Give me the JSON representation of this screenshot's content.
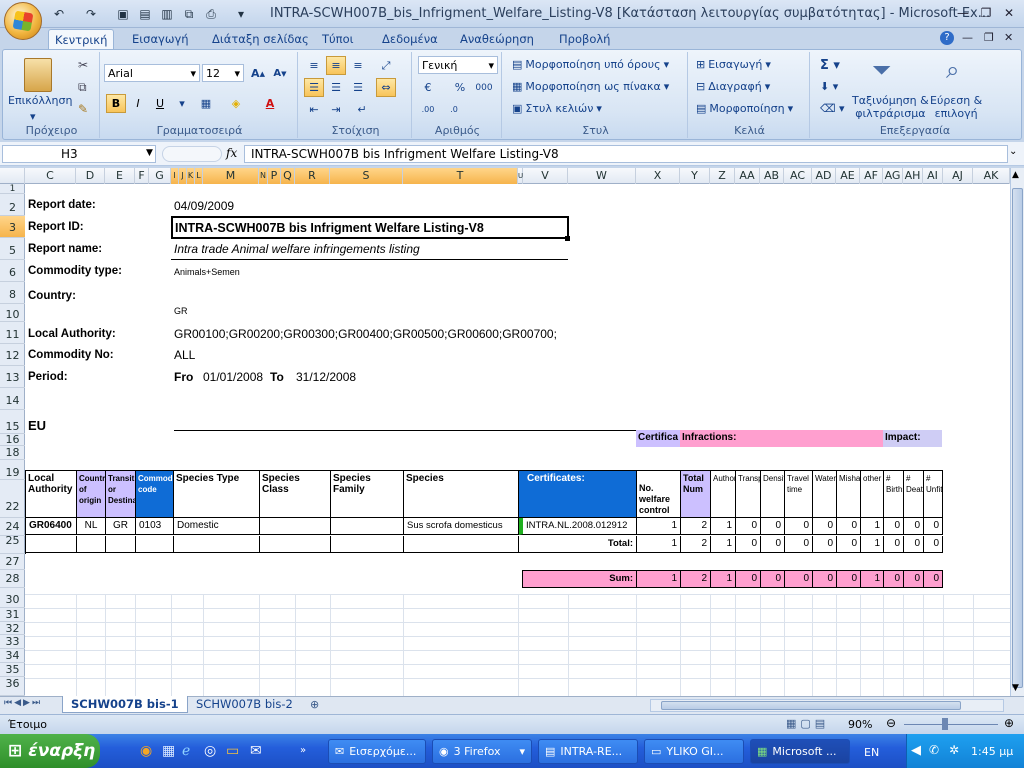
{
  "window": {
    "title": "INTRA-SCWH007B_bis_Infrigment_Welfare_Listing-V8  [Κατάσταση λειτουργίας συμβατότητας] - Microsoft Ex..."
  },
  "ribbon_tabs": [
    "Κεντρική",
    "Εισαγωγή",
    "Διάταξη σελίδας",
    "Τύποι",
    "Δεδομένα",
    "Αναθεώρηση",
    "Προβολή"
  ],
  "ribbon": {
    "clipboard": {
      "paste": "Επικόλληση",
      "label": "Πρόχειρο"
    },
    "font": {
      "name": "Arial",
      "size": "12",
      "label": "Γραμματοσειρά"
    },
    "alignment": {
      "label": "Στοίχιση"
    },
    "number": {
      "format": "Γενική",
      "label": "Αριθμός"
    },
    "styles": {
      "conditional": "Μορφοποίηση υπό όρους",
      "as_table": "Μορφοποίηση ως πίνακα",
      "cell_styles": "Στυλ κελιών",
      "label": "Στυλ"
    },
    "cells": {
      "insert": "Εισαγωγή",
      "delete": "Διαγραφή",
      "format": "Μορφοποίηση",
      "label": "Κελιά"
    },
    "editing": {
      "sort": "Ταξινόμηση &",
      "sort2": "φιλτράρισμα",
      "find": "Εύρεση &",
      "find2": "επιλογή",
      "label": "Επεξεργασία"
    }
  },
  "formula_bar": {
    "name_box": "H3",
    "fx": "fx",
    "value": "INTRA-SCWH007B bis Infrigment Welfare Listing-V8"
  },
  "columns": [
    "C",
    "D",
    "E",
    "F",
    "G",
    "I",
    "J",
    "K",
    "L",
    "M",
    "N",
    "P",
    "Q",
    "R",
    "S",
    "T",
    "U",
    "V",
    "W",
    "X",
    "Y",
    "Z",
    "AA",
    "AB",
    "AC",
    "AD",
    "AE",
    "AF",
    "AG",
    "AH",
    "AI",
    "AJ",
    "AK"
  ],
  "rows": [
    "1",
    "2",
    "3",
    "5",
    "6",
    "8",
    "10",
    "11",
    "12",
    "13",
    "14",
    "15",
    "16",
    "18",
    "19",
    "22",
    "24",
    "25",
    "27",
    "28",
    "30",
    "31",
    "32",
    "33",
    "34",
    "35",
    "36"
  ],
  "report": {
    "date_label": "Report date:",
    "date": "04/09/2009",
    "id_label": "Report ID:",
    "id": "INTRA-SCWH007B bis Infrigment Welfare Listing-V8",
    "name_label": "Report name:",
    "name": "Intra trade Animal welfare infringements listing",
    "commodity_label": "Commodity type:",
    "commodity": "Animals+Semen",
    "country_label": "Country:",
    "country": "GR",
    "authority_label": "Local Authority:",
    "authority": "GR00100;GR00200;GR00300;GR00400;GR00500;GR00600;GR00700;",
    "commodity_no_label": "Commodity No:",
    "commodity_no": "ALL",
    "period_label": "Period:",
    "from_label": "Fro",
    "from": "01/01/2008",
    "to_label": "To",
    "to": "31/12/2008",
    "section": "EU"
  },
  "group_headers": {
    "certifica": "Certifica",
    "infractions": "Infractions:",
    "impact": "Impact:"
  },
  "table_headers": [
    "Local Authority",
    "Country of origin",
    "Transit or Destination",
    "Commodity code",
    "Species Type",
    "Species Class",
    "Species Family",
    "Species",
    "Certificates:",
    "No. welfare control",
    "Total Num",
    "Authorisation",
    "Transport",
    "Density",
    "Travel time",
    "Watering/feeding",
    "Mishandling",
    "other",
    "# Births",
    "# Deaths",
    "# Unfit"
  ],
  "table_row": [
    "GR06400",
    "NL",
    "GR",
    "0103",
    "Domestic",
    "",
    "",
    "Sus scrofa domesticus",
    "INTRA.NL.2008.012912",
    "1",
    "2",
    "1",
    "0",
    "0",
    "0",
    "0",
    "0",
    "1",
    "0",
    "0",
    "0"
  ],
  "total_row": {
    "label": "Total:",
    "values": [
      "1",
      "2",
      "1",
      "0",
      "0",
      "0",
      "0",
      "0",
      "1",
      "0",
      "0",
      "0"
    ]
  },
  "sum_row": {
    "label": "Sum:",
    "values": [
      "1",
      "2",
      "1",
      "0",
      "0",
      "0",
      "0",
      "0",
      "1",
      "0",
      "0",
      "0"
    ]
  },
  "sheets": [
    "SCHW007B bis-1",
    "SCHW007B bis-2"
  ],
  "status": {
    "ready": "Έτοιμο",
    "zoom": "90%"
  },
  "taskbar": {
    "start": "έναρξη",
    "items": [
      "Εισερχόμε...",
      "3 Firefox",
      "INTRA-RE...",
      "YLIKO GI...",
      "Microsoft ..."
    ],
    "lang": "EN",
    "time": "1:45 μμ"
  },
  "colors": {
    "header_purple": "#ccc0ff",
    "header_blue": "#0f6cd6",
    "header_pink": "#ff9fcf",
    "impact_lavender": "#cfcdf5"
  }
}
